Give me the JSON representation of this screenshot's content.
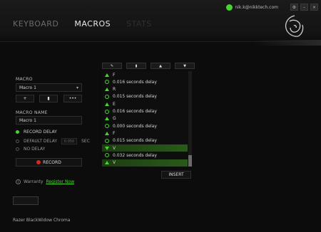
{
  "titlebar": {
    "email": "nik.k@nikktech.com",
    "settings_glyph": "⚙",
    "minimize_glyph": "–",
    "close_glyph": "×"
  },
  "tabs": [
    {
      "label": "KEYBOARD"
    },
    {
      "label": "MACROS"
    },
    {
      "label": "STATS"
    }
  ],
  "left": {
    "macro_label": "MACRO",
    "macro_select": "Macro 1",
    "add": "+",
    "delete_glyph": "▮",
    "more": "•••",
    "macro_name_label": "MACRO NAME",
    "macro_name_value": "Macro 1",
    "radios": [
      {
        "label": "RECORD DELAY",
        "on": true
      },
      {
        "label": "DEFAULT DELAY",
        "on": false,
        "value": "0.050",
        "unit": "SEC"
      },
      {
        "label": "NO DELAY",
        "on": false
      }
    ],
    "record_label": "RECORD"
  },
  "toolbar": {
    "edit_glyph": "✎",
    "delete_glyph": "▮",
    "up_glyph": "▲",
    "down_glyph": "▼"
  },
  "list": [
    {
      "kind": "up",
      "text": "F"
    },
    {
      "kind": "delay",
      "text": "0.016 seconds delay"
    },
    {
      "kind": "up",
      "text": "R"
    },
    {
      "kind": "delay",
      "text": "0.015 seconds delay"
    },
    {
      "kind": "up",
      "text": "E"
    },
    {
      "kind": "delay",
      "text": "0.016 seconds delay"
    },
    {
      "kind": "up",
      "text": "G"
    },
    {
      "kind": "delay",
      "text": "0.000 seconds delay"
    },
    {
      "kind": "up",
      "text": "F"
    },
    {
      "kind": "delay",
      "text": "0.015 seconds delay"
    },
    {
      "kind": "down",
      "text": "V"
    },
    {
      "kind": "delay",
      "text": "0.032 seconds delay"
    },
    {
      "kind": "up",
      "text": "V"
    }
  ],
  "insert_label": "INSERT",
  "footer": {
    "warranty_label": "Warranty",
    "register_label": "Register Now",
    "device_name": "Razer BlackWidow Chroma"
  },
  "colors": {
    "accent": "#44d62c",
    "record": "#d42a1c"
  }
}
